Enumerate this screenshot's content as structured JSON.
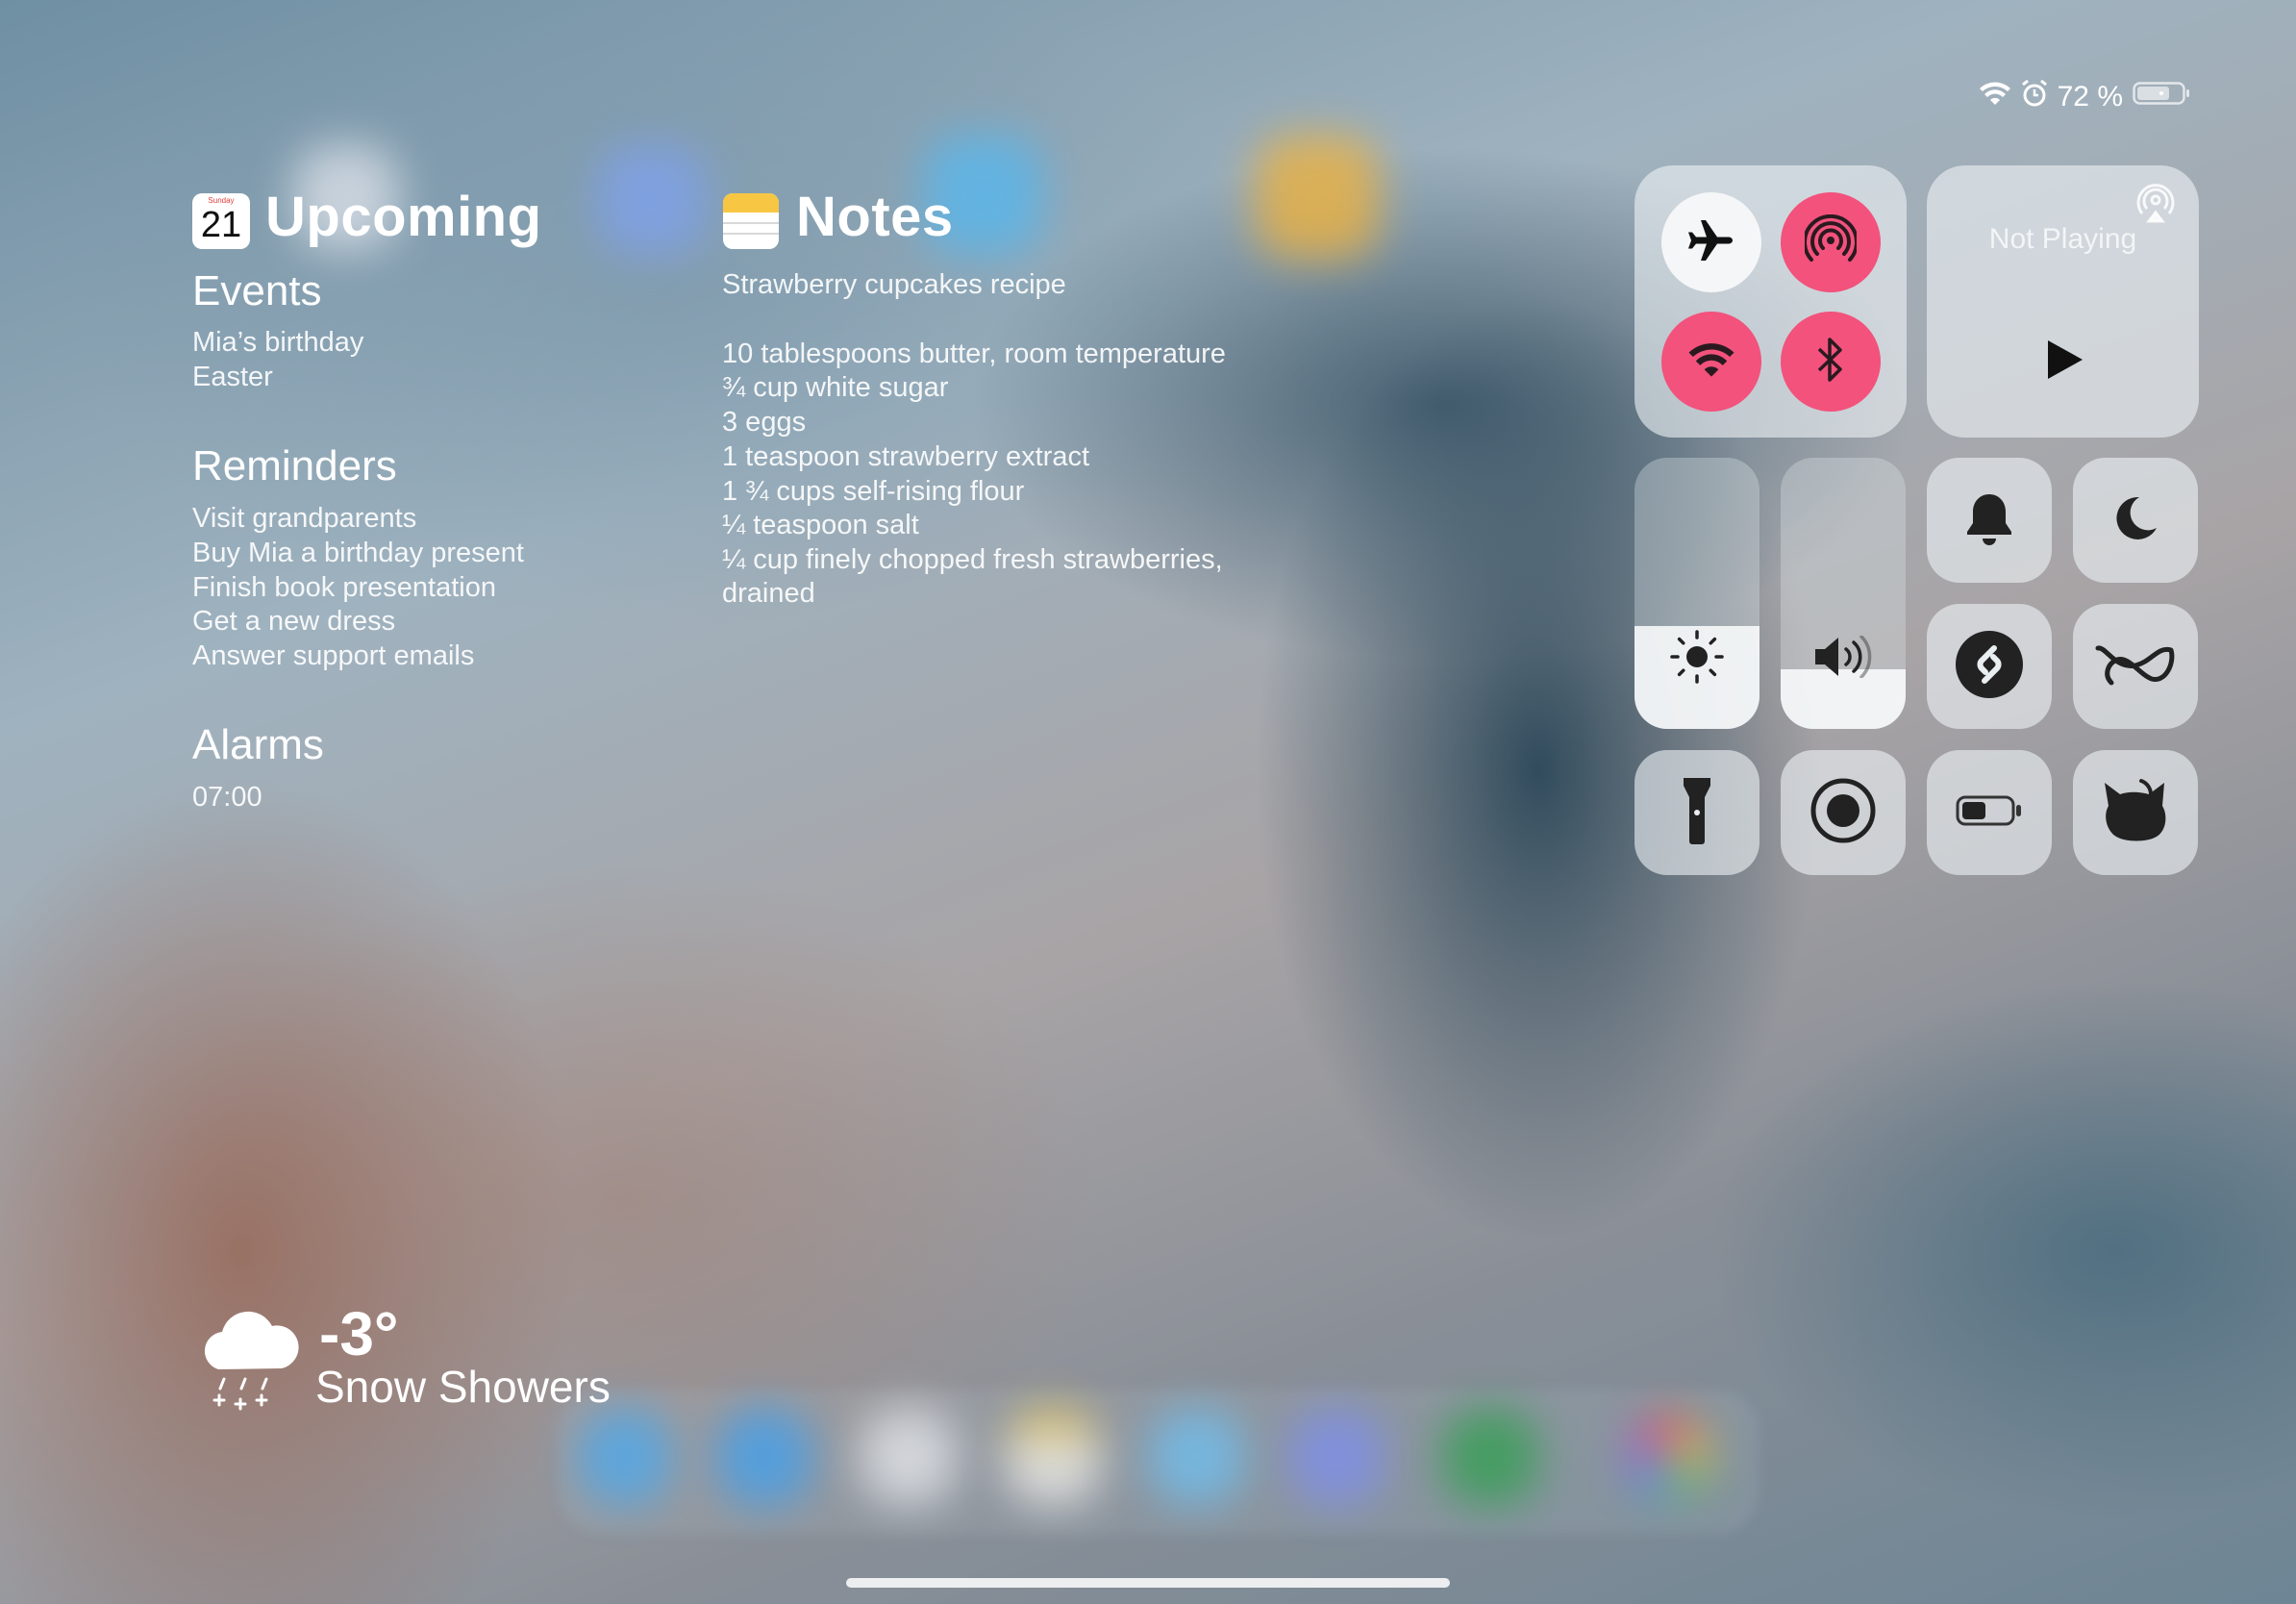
{
  "status_bar": {
    "battery_percent": "72 %"
  },
  "calendar_widget": {
    "icon_weekday": "Sunday",
    "icon_day": "21",
    "title": "Upcoming",
    "events_title": "Events",
    "events": [
      "Mia’s birthday",
      "Easter"
    ],
    "reminders_title": "Reminders",
    "reminders": [
      "Visit grandparents",
      "Buy Mia a birthday present",
      "Finish book presentation",
      "Get a new dress",
      "Answer support emails"
    ],
    "alarms_title": "Alarms",
    "alarms": [
      "07:00"
    ]
  },
  "notes_widget": {
    "title": "Notes",
    "note_title": "Strawberry cupcakes recipe",
    "lines": [
      "10 tablespoons butter, room temperature",
      "¾ cup white sugar",
      "3 eggs",
      "1 teaspoon strawberry extract",
      "1 ¾ cups self-rising flour",
      "¼ teaspoon salt",
      "¼ cup finely chopped fresh strawberries,",
      "drained"
    ]
  },
  "weather_widget": {
    "temperature": "-3°",
    "condition": "Snow Showers"
  },
  "control_center": {
    "now_playing": "Not Playing",
    "toggles": {
      "airplane_mode": "off",
      "airdrop": "on",
      "wifi": "on",
      "bluetooth": "on"
    },
    "brightness_level": 0.38,
    "volume_level": 0.22,
    "accent_color": "#f2527c"
  }
}
